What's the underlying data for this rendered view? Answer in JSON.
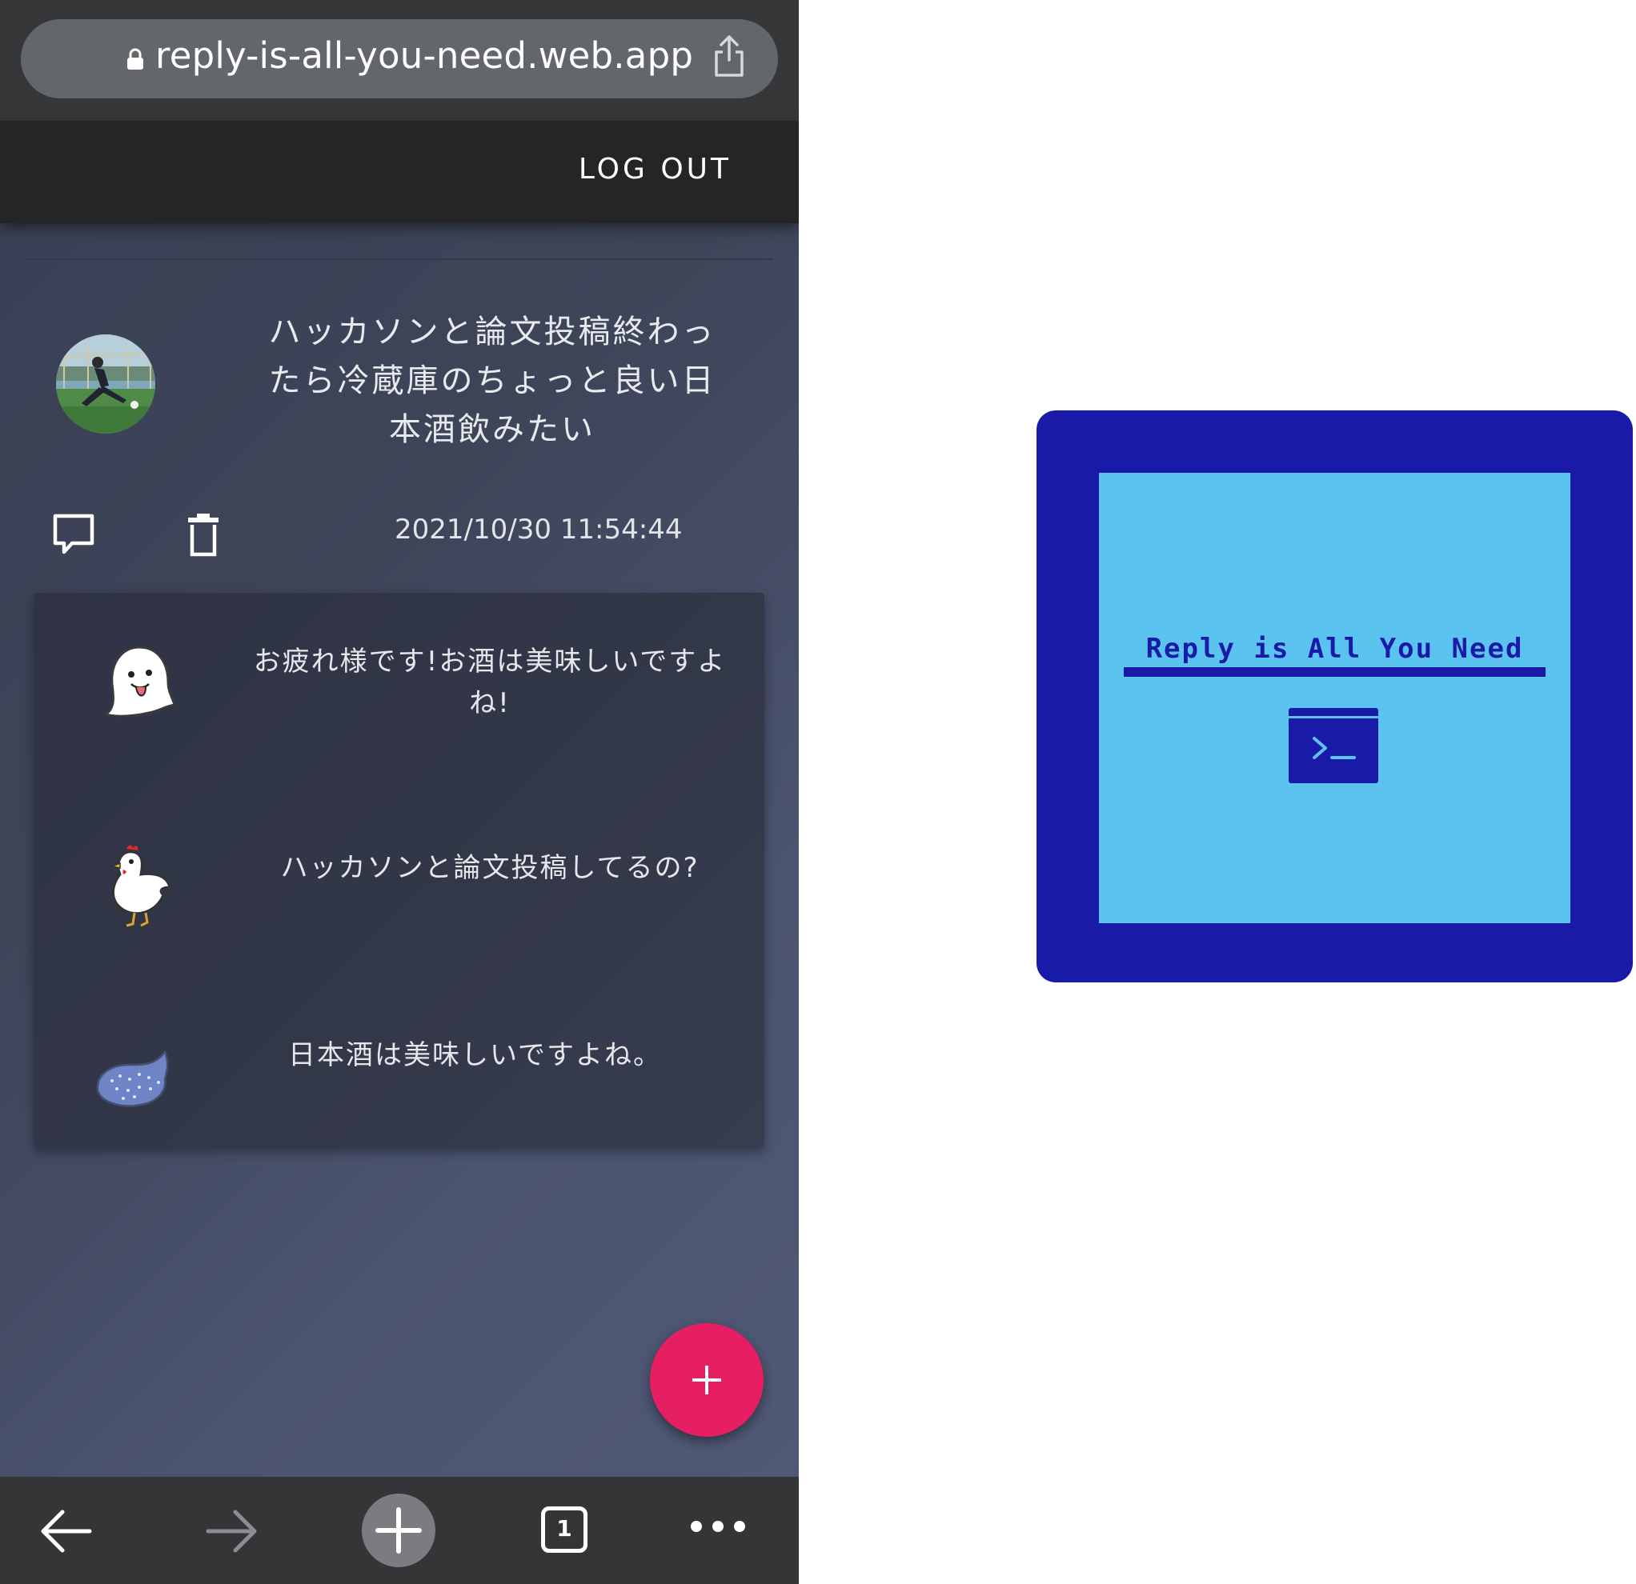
{
  "browser": {
    "url": "reply-is-all-you-need.web.app",
    "tab_count": "1"
  },
  "app_bar": {
    "logout_label": "LOG OUT"
  },
  "post": {
    "text": "ハッカソンと論文投稿終わったら冷蔵庫のちょっと良い日本酒飲みたい",
    "timestamp": "2021/10/30 11:54:44"
  },
  "replies": [
    {
      "avatar": "ghost-icon",
      "text": "お疲れ様です!お酒は美味しいですよね!"
    },
    {
      "avatar": "chicken-icon",
      "text": "ハッカソンと論文投稿してるの?"
    },
    {
      "avatar": "whale-shark-icon",
      "text": "日本酒は美味しいですよね。"
    }
  ],
  "logo": {
    "title": "Reply is All You Need"
  },
  "colors": {
    "fab": "#e61f63",
    "logo_dark": "#1a1aa8",
    "logo_light": "#5bc3f0",
    "app_bar": "#242526"
  }
}
